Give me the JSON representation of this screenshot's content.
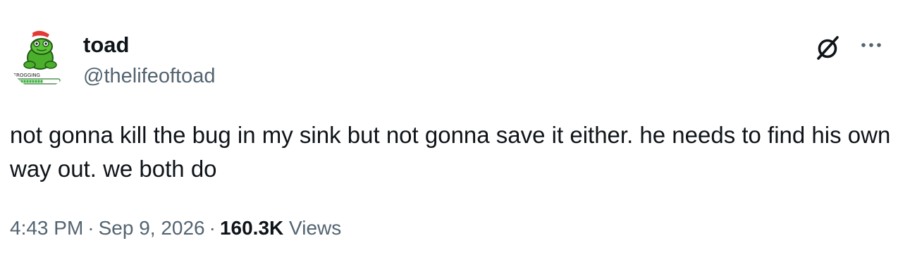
{
  "author": {
    "display_name": "toad",
    "handle": "@thelifeoftoad",
    "avatar_icon": "frog-with-santa-hat",
    "avatar_caption": "FROGGING"
  },
  "actions": {
    "grok_icon": "grok-icon",
    "more_icon": "more-horizontal-icon"
  },
  "tweet": {
    "text": "not gonna kill the bug in my sink but not gonna save it either. he needs to find his own way out. we both do",
    "time": "4:43 PM",
    "date": "Sep 9, 2026",
    "separator": "·",
    "views_count": "160.3K",
    "views_label": "Views"
  },
  "colors": {
    "text_primary": "#0f1419",
    "text_secondary": "#536471",
    "frog_green": "#4caf2c",
    "hat_red": "#e53935",
    "progress_green": "#3bb33b"
  }
}
